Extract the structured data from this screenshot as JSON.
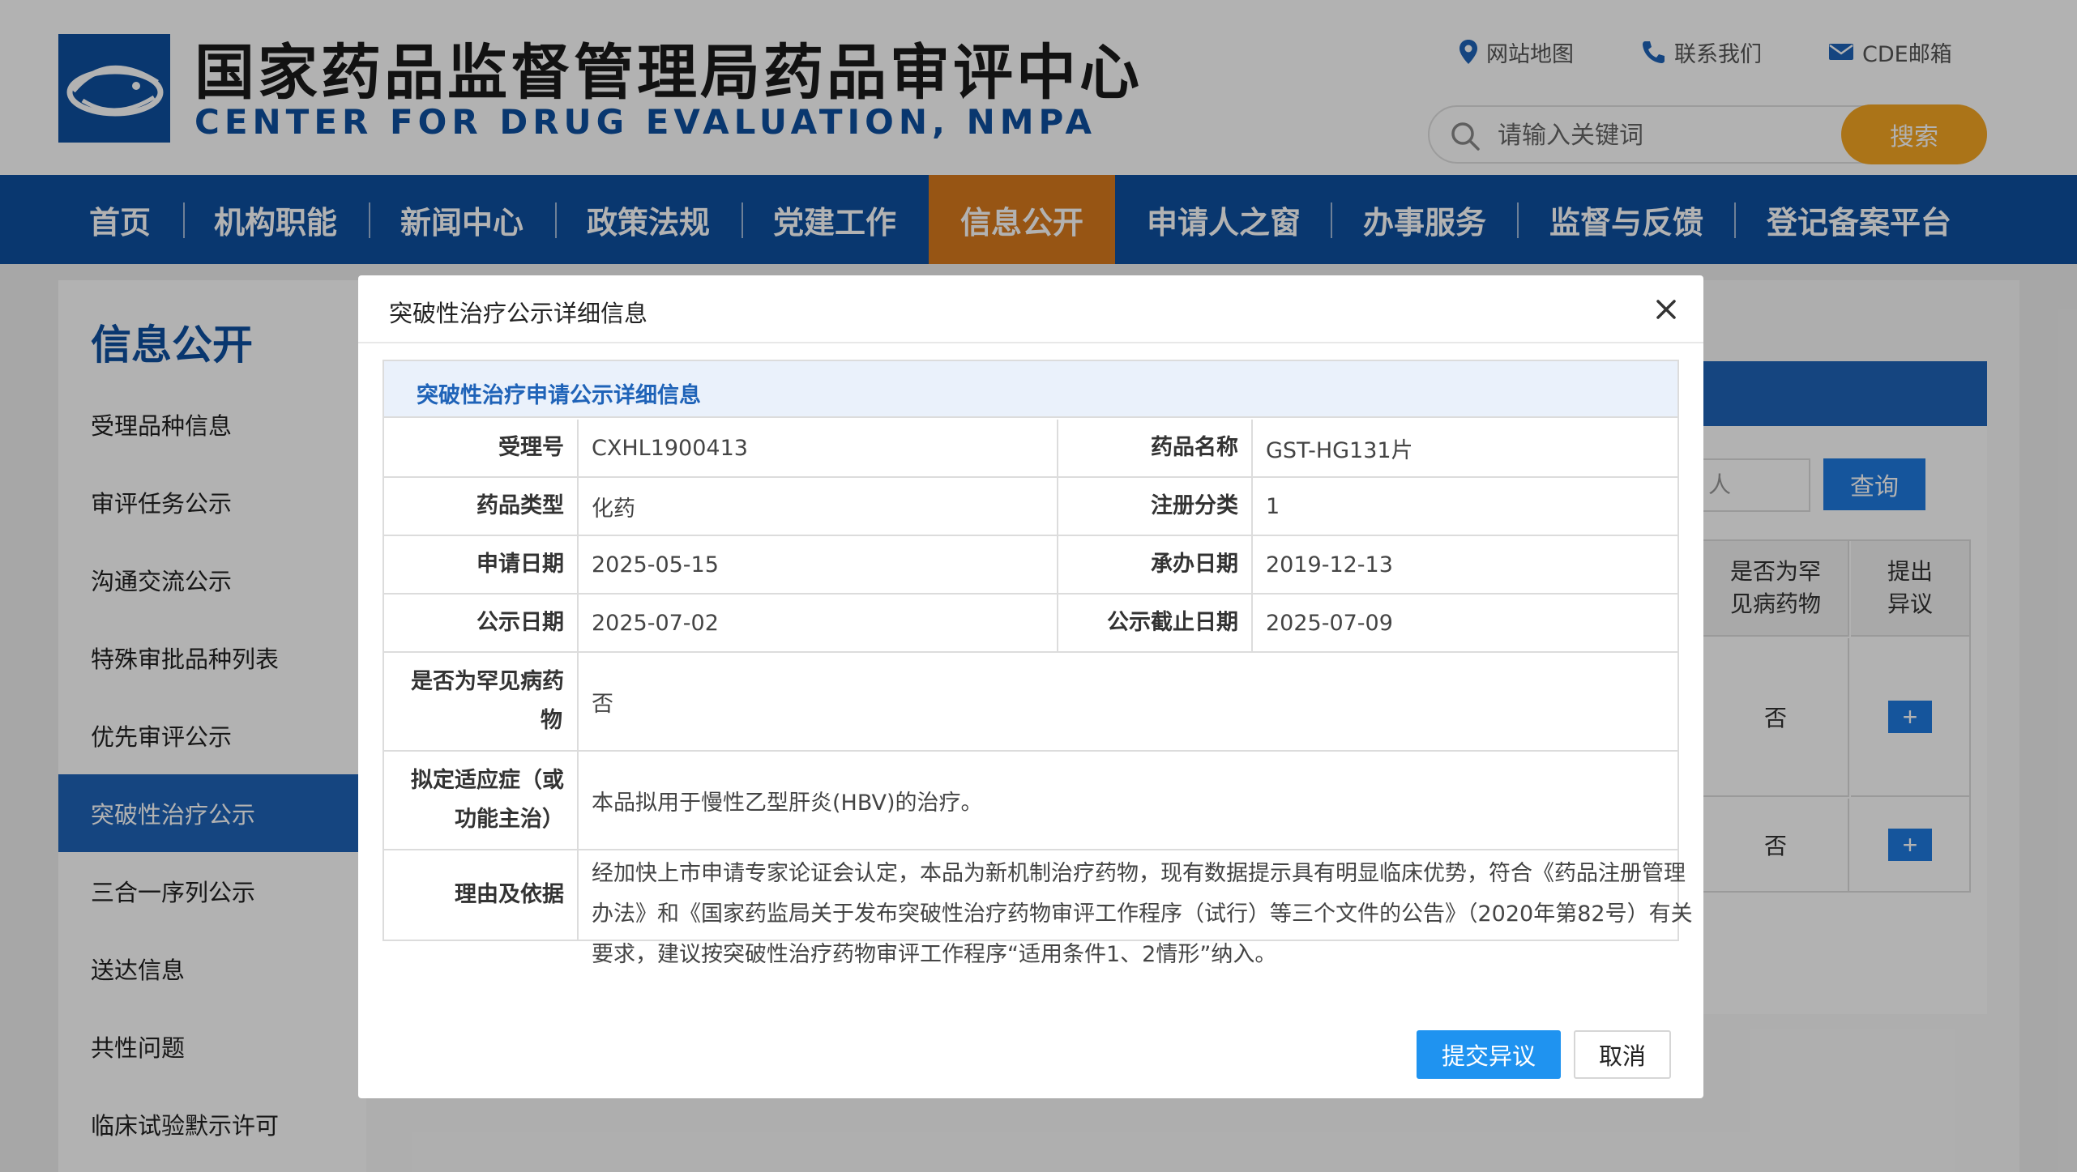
{
  "header": {
    "title_cn": "国家药品监督管理局药品审评中心",
    "title_en": "CENTER FOR DRUG EVALUATION, NMPA",
    "links": [
      {
        "label": "网站地图",
        "icon": "location-pin-icon"
      },
      {
        "label": "联系我们",
        "icon": "phone-icon"
      },
      {
        "label": "CDE邮箱",
        "icon": "mail-icon"
      }
    ],
    "search_placeholder": "请输入关键词",
    "search_button": "搜索"
  },
  "nav": {
    "active_index": 5,
    "items": [
      "首页",
      "机构职能",
      "新闻中心",
      "政策法规",
      "党建工作",
      "信息公开",
      "申请人之窗",
      "办事服务",
      "监督与反馈",
      "登记备案平台"
    ]
  },
  "sidebar": {
    "title": "信息公开",
    "active_index": 5,
    "items": [
      "受理品种信息",
      "审评任务公示",
      "沟通交流公示",
      "特殊审批品种列表",
      "优先审评公示",
      "突破性治疗公示",
      "三合一序列公示",
      "送达信息",
      "共性问题",
      "临床试验默示许可"
    ]
  },
  "background": {
    "search_fragment": "人",
    "query_button": "查询",
    "col_rare": "是否为罕见病药物",
    "col_objection": "提出异议",
    "rows": [
      {
        "rare": "否",
        "action": "+"
      },
      {
        "rare": "否",
        "action": "+"
      }
    ]
  },
  "modal": {
    "title": "突破性治疗公示详细信息",
    "section_title": "突破性治疗申请公示详细信息",
    "fields": {
      "accept_no_label": "受理号",
      "accept_no": "CXHL1900413",
      "drug_name_label": "药品名称",
      "drug_name": "GST-HG131片",
      "drug_type_label": "药品类型",
      "drug_type": "化药",
      "reg_class_label": "注册分类",
      "reg_class": "1",
      "apply_date_label": "申请日期",
      "apply_date": "2025-05-15",
      "undertake_date_label": "承办日期",
      "undertake_date": "2019-12-13",
      "publish_date_label": "公示日期",
      "publish_date": "2025-07-02",
      "deadline_label": "公示截止日期",
      "deadline": "2025-07-09",
      "rare_label_1": "是否为罕见病药",
      "rare_label_2": "物",
      "rare": "否",
      "indication_label_1": "拟定适应症（或",
      "indication_label_2": "功能主治）",
      "indication": "本品拟用于慢性乙型肝炎(HBV)的治疗。",
      "reason_label": "理由及依据",
      "reason_line1": "经加快上市申请专家论证会认定，本品为新机制治疗药物，现有数据提示具有明显临床优势，符合《药品注册管理",
      "reason_line2": "办法》和《国家药监局关于发布突破性治疗药物审评工作程序（试行）等三个文件的公告》（2020年第82号）有关",
      "reason_line3": "要求，建议按突破性治疗药物审评工作程序“适用条件1、2情形”纳入。"
    },
    "submit_button": "提交异议",
    "cancel_button": "取消"
  },
  "colors": {
    "brand_blue": "#0d4fa0",
    "nav_active": "#d97a1e",
    "search_button": "#f5a623",
    "submit_button": "#1f93f0"
  }
}
